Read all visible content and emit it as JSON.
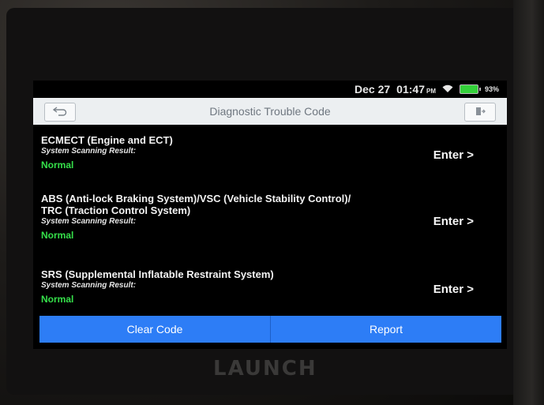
{
  "device": {
    "brand_logo": "LAUNCH"
  },
  "status_bar": {
    "date": "Dec 27",
    "time": "01:47",
    "ampm": "PM",
    "battery_pct": "93%",
    "battery_level": 0.93
  },
  "header": {
    "title": "Diagnostic Trouble Code",
    "back_icon": "back-arrow-icon",
    "exit_icon": "exit-icon"
  },
  "systems": [
    {
      "name_line1": "ECMECT (Engine and ECT)",
      "name_line2": "",
      "result_label": "System Scanning Result:",
      "result": "Normal",
      "action": "Enter >"
    },
    {
      "name_line1": "ABS (Anti-lock Braking System)/VSC (Vehicle Stability Control)/",
      "name_line2": "TRC (Traction Control System)",
      "result_label": "System Scanning Result:",
      "result": "Normal",
      "action": "Enter >"
    },
    {
      "name_line1": "SRS (Supplemental Inflatable Restraint System)",
      "name_line2": "",
      "result_label": "System Scanning Result:",
      "result": "Normal",
      "action": "Enter >"
    }
  ],
  "footer": {
    "clear_code": "Clear Code",
    "report": "Report"
  },
  "colors": {
    "accent": "#2d7df6",
    "normal": "#35e04a",
    "title_bar": "#eceff1"
  }
}
